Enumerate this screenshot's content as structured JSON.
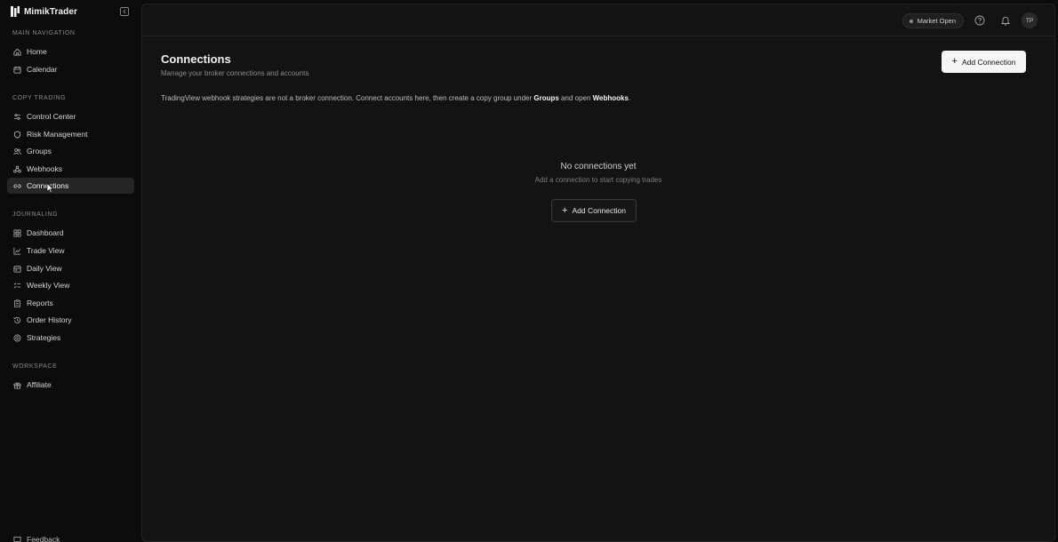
{
  "brand": {
    "name": "MimikTrader",
    "logo_icon": "stack-logo-icon"
  },
  "sidebar": {
    "sections": [
      {
        "label": "MAIN NAVIGATION",
        "items": [
          {
            "label": "Home",
            "icon": "home-icon"
          },
          {
            "label": "Calendar",
            "icon": "calendar-icon"
          }
        ]
      },
      {
        "label": "COPY TRADING",
        "items": [
          {
            "label": "Control Center",
            "icon": "sliders-icon"
          },
          {
            "label": "Risk Management",
            "icon": "shield-icon"
          },
          {
            "label": "Groups",
            "icon": "users-icon"
          },
          {
            "label": "Webhooks",
            "icon": "webhook-icon"
          },
          {
            "label": "Connections",
            "icon": "link-icon",
            "active": true
          }
        ]
      },
      {
        "label": "JOURNALING",
        "items": [
          {
            "label": "Dashboard",
            "icon": "dashboard-icon"
          },
          {
            "label": "Trade View",
            "icon": "chart-icon"
          },
          {
            "label": "Daily View",
            "icon": "calendar-day-icon"
          },
          {
            "label": "Weekly View",
            "icon": "list-check-icon"
          },
          {
            "label": "Reports",
            "icon": "clipboard-icon"
          },
          {
            "label": "Order History",
            "icon": "history-icon"
          },
          {
            "label": "Strategies",
            "icon": "target-icon"
          }
        ]
      },
      {
        "label": "WORKSPACE",
        "items": [
          {
            "label": "Affiliate",
            "icon": "gift-icon"
          }
        ]
      }
    ],
    "feedback_label": "Feedback"
  },
  "topbar": {
    "market_status": "Market Open",
    "avatar_initials": "TP"
  },
  "page": {
    "title": "Connections",
    "subtitle": "Manage your broker connections and accounts",
    "add_button_label": "Add Connection",
    "notice": {
      "text_before": "TradingView webhook strategies are not a broker connection. Connect accounts here, then create a copy group under ",
      "groups_link": "Groups",
      "text_middle": " and open ",
      "webhooks_link": "Webhooks",
      "text_after": "."
    },
    "empty_state": {
      "title": "No connections yet",
      "subtitle": "Add a connection to start copying trades",
      "button_label": "Add Connection"
    }
  },
  "colors": {
    "background": "#0c0c0c",
    "panel": "#131313",
    "active_item": "#262626",
    "primary_button": "#f5f5f5"
  }
}
